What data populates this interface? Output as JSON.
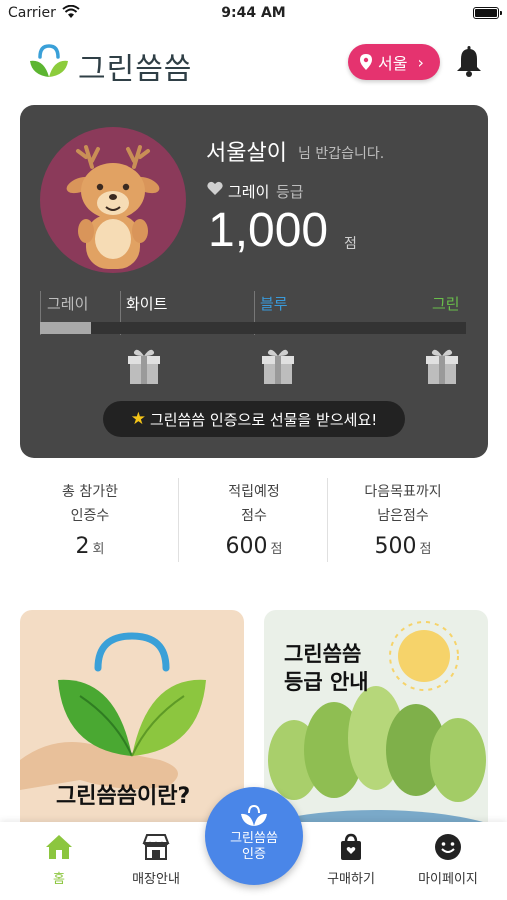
{
  "status_bar": {
    "carrier": "Carrier",
    "time": "9:44 AM"
  },
  "header": {
    "app_name": "그린씀씀",
    "location": "서울"
  },
  "grade_card": {
    "user_name": "서울살이",
    "greeting": "님 반갑습니다.",
    "grade_name": "그레이",
    "grade_suffix": "등급",
    "points": "1,000",
    "points_unit": "점",
    "levels": [
      {
        "label": "그레이",
        "color": "#bdbdbd"
      },
      {
        "label": "화이트",
        "color": "#ffffff"
      },
      {
        "label": "블루",
        "color": "#3a9ad9"
      },
      {
        "label": "그린",
        "color": "#6abf4b"
      }
    ],
    "progress_fraction": 0.12,
    "cta_text": "그린씀씀 인증으로 선물을 받으세요!"
  },
  "stats": [
    {
      "line1": "총 참가한",
      "line2": "인증수",
      "value": "2",
      "unit": "회"
    },
    {
      "line1": "적립예정",
      "line2": "점수",
      "value": "600",
      "unit": "점"
    },
    {
      "line1": "다음목표까지",
      "line2": "남은점수",
      "value": "500",
      "unit": "점"
    }
  ],
  "banners": [
    {
      "title": "그린씀씀이란?"
    },
    {
      "title_line1": "그린씀씀",
      "title_line2": "등급 안내"
    }
  ],
  "nav": {
    "home": "홈",
    "store": "매장안내",
    "certify_line1": "그린씀씀",
    "certify_line2": "인증",
    "purchase": "구매하기",
    "mypage": "마이페이지"
  },
  "colors": {
    "accent_pink": "#e5336f",
    "card_bg": "#474747",
    "fab_blue": "#4a86e8",
    "active_green": "#8cc63f"
  }
}
